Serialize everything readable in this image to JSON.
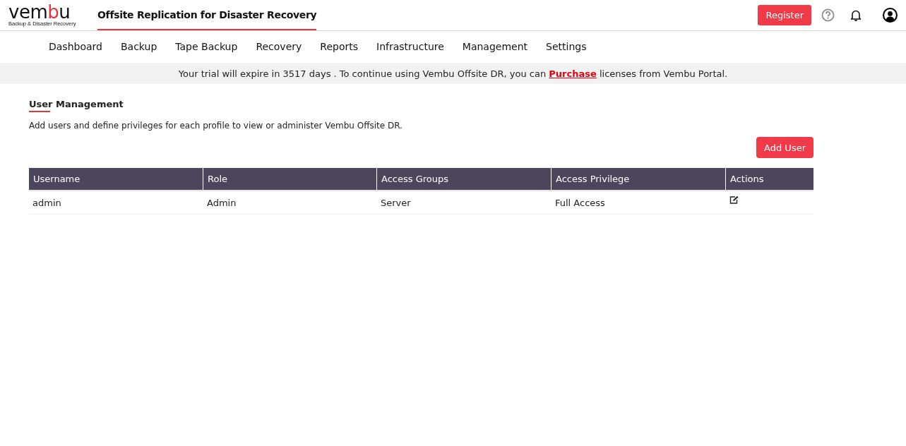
{
  "logo": {
    "segments": [
      {
        "text": "vem",
        "color": "#111111"
      },
      {
        "text": "b",
        "color": "#e8323c"
      },
      {
        "text": "u",
        "color": "#111111"
      }
    ],
    "tagline": "Backup & Disaster Recovery"
  },
  "product_tab": {
    "label": "Offsite Replication for Disaster Recovery",
    "selected": true
  },
  "register_button": "Register",
  "nav": [
    {
      "label": "Dashboard",
      "selected": false
    },
    {
      "label": "Backup",
      "selected": false
    },
    {
      "label": "Tape Backup",
      "selected": false
    },
    {
      "label": "Recovery",
      "selected": false
    },
    {
      "label": "Reports",
      "selected": false
    },
    {
      "label": "Infrastructure",
      "selected": false
    },
    {
      "label": "Management",
      "selected": false
    },
    {
      "label": "Settings",
      "selected": false
    }
  ],
  "banner": {
    "before": "Your trial will expire in 3517 days . To continue using Vembu Offsite DR, you can ",
    "link": "Purchase",
    "after": " licenses from Vembu Portal."
  },
  "section": {
    "title": "User Management",
    "description": "Add users and define privileges for each profile to view or administer Vembu Offsite DR.",
    "add_button": "Add User"
  },
  "table": {
    "columns": [
      "Username",
      "Role",
      "Access Groups",
      "Access Privilege",
      "Actions"
    ],
    "rows": [
      {
        "cells": [
          "admin",
          "Admin",
          "Server",
          "Full Access"
        ]
      }
    ]
  }
}
